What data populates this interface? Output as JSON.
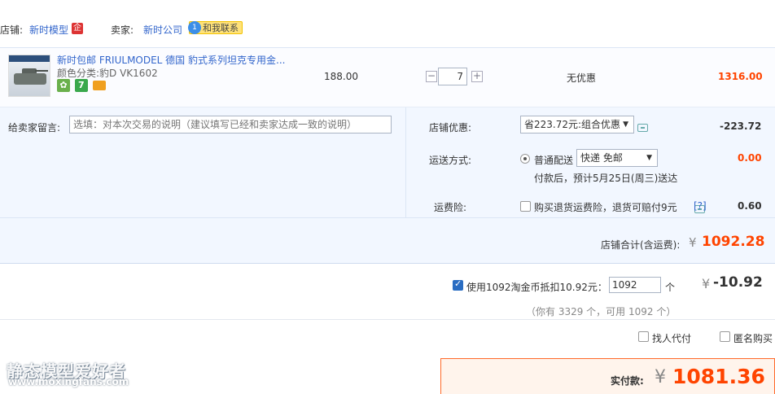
{
  "shop": {
    "label": "店铺:",
    "name": "新时模型",
    "seller_label": "卖家:",
    "seller_name": "新时公司",
    "contact_label": "和我联系"
  },
  "item": {
    "title": "新时包邮 FRIULMODEL 德国 豹式系列坦克专用金...",
    "sku": "颜色分类:豹D VK1602",
    "price": "188.00",
    "quantity": "7",
    "minus": "−",
    "plus": "+",
    "discount": "无优惠",
    "total": "1316.00",
    "badge_seven": "7"
  },
  "memo": {
    "label": "给卖家留言:",
    "placeholder": "选填：对本次交易的说明（建议填写已经和卖家达成一致的说明）"
  },
  "shop_discount": {
    "label": "店铺优惠:",
    "selected": "省223.72元:组合优惠",
    "amount": "-223.72"
  },
  "shipping": {
    "label": "运送方式:",
    "option": "普通配送",
    "selected": "快递 免邮",
    "amount": "0.00",
    "eta": "付款后，预计5月25日(周三)送达"
  },
  "insurance": {
    "label": "运费险:",
    "option": "购买退货运费险，退货可赔付9元",
    "help": "[?]",
    "amount": "0.60"
  },
  "subtotal": {
    "label": "店铺合计(含运费):",
    "currency": "¥",
    "amount": "1092.28"
  },
  "coins": {
    "label": "使用1092淘金币抵扣10.92元：",
    "value": "1092",
    "unit": "个",
    "currency": "¥",
    "amount": "-10.92",
    "note": "（你有 3329 个，可用 1092 个）"
  },
  "options": {
    "proxy_pay": "找人代付",
    "anonymous": "匿名购买"
  },
  "payment": {
    "label": "实付款:",
    "currency": "¥",
    "amount": "1081.36"
  },
  "watermark": {
    "title": "静态模型爱好者",
    "url": "www.moxingfans.com"
  },
  "colors": {
    "accent": "#ff4400",
    "link": "#3366cc",
    "panel": "#f2f7ff"
  }
}
